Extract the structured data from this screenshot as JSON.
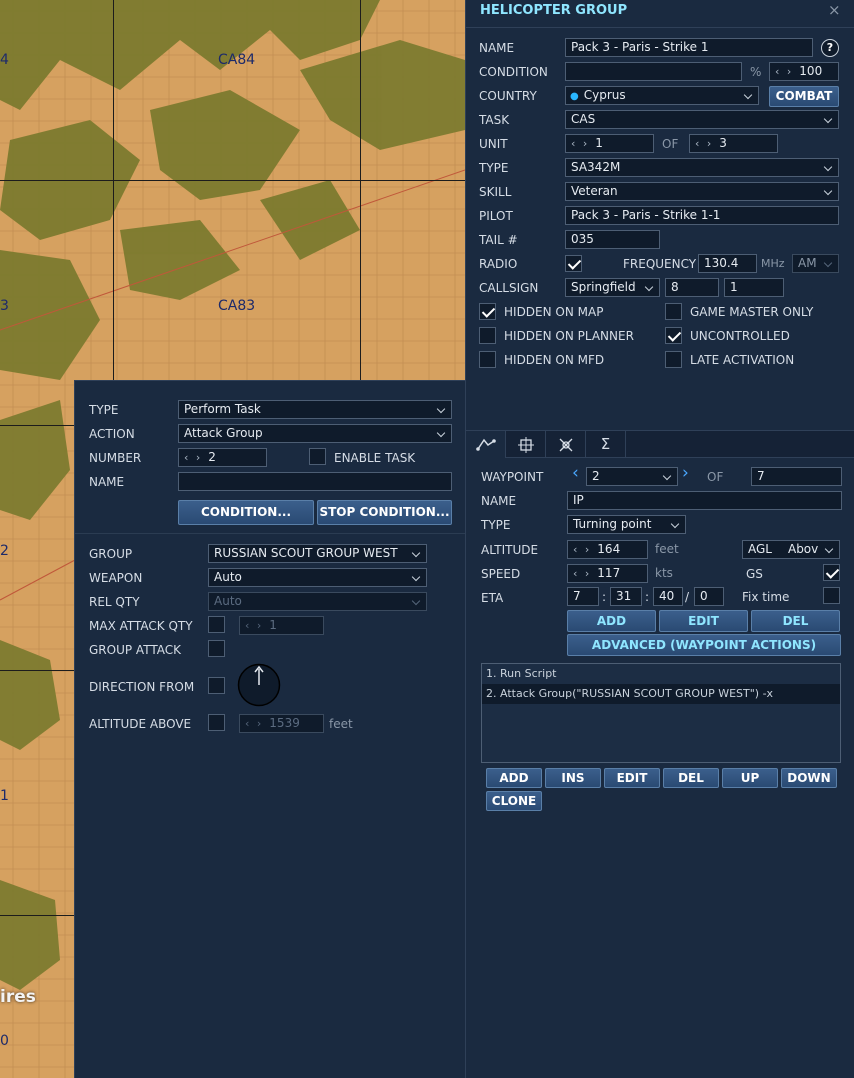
{
  "map": {
    "grid_labels": [
      "CA84",
      "CA83"
    ],
    "edge_labels": [
      "4",
      "3",
      "2",
      "1",
      "0"
    ],
    "town_label": "ires"
  },
  "heli": {
    "title": "HELICOPTER GROUP",
    "close": "×",
    "name_label": "NAME",
    "name_value": "Pack 3 - Paris - Strike 1",
    "help": "?",
    "condition_label": "CONDITION",
    "percent": "%",
    "probability": "100",
    "country_label": "COUNTRY",
    "country_value": "Cyprus",
    "combat": "COMBAT",
    "task_label": "TASK",
    "task_value": "CAS",
    "unit_label": "UNIT",
    "unit_value": "1",
    "of": "OF",
    "unit_total": "3",
    "type_label": "TYPE",
    "type_value": "SA342M",
    "skill_label": "SKILL",
    "skill_value": "Veteran",
    "pilot_label": "PILOT",
    "pilot_value": "Pack 3 - Paris - Strike 1-1",
    "tail_label": "TAIL #",
    "tail_value": "035",
    "radio_label": "RADIO",
    "frequency_label": "FREQUENCY",
    "frequency_value": "130.4",
    "mhz": "MHz",
    "modulation": "AM",
    "callsign_label": "CALLSIGN",
    "callsign_value": "Springfield",
    "callsign_num1": "8",
    "callsign_num2": "1",
    "hidden_map": "HIDDEN ON MAP",
    "game_master": "GAME MASTER ONLY",
    "hidden_planner": "HIDDEN ON PLANNER",
    "uncontrolled": "UNCONTROLLED",
    "hidden_mfd": "HIDDEN ON MFD",
    "late_activation": "LATE ACTIVATION"
  },
  "tabs": {
    "sum": "Σ"
  },
  "waypoint": {
    "waypoint_label": "WAYPOINT",
    "waypoint_value": "2",
    "of": "OF",
    "waypoint_total": "7",
    "name_label": "NAME",
    "name_value": "IP",
    "type_label": "TYPE",
    "type_value": "Turning point",
    "altitude_label": "ALTITUDE",
    "altitude_value": "164",
    "feet": "feet",
    "alt_type": "AGL",
    "alt_type2": "Abov",
    "speed_label": "SPEED",
    "speed_value": "117",
    "kts": "kts",
    "gs": "GS",
    "eta_label": "ETA",
    "eta_d": "7",
    "eta_h": "31",
    "eta_m": "40",
    "eta_s": "0",
    "colon": ":",
    "slash": "/",
    "fix_time": "Fix time",
    "add": "ADD",
    "edit": "EDIT",
    "del": "DEL",
    "advanced": "ADVANCED (WAYPOINT ACTIONS)",
    "actions": [
      "1. Run Script",
      "2. Attack Group(\"RUSSIAN SCOUT GROUP WEST\")  -x"
    ],
    "btn_add": "ADD",
    "btn_ins": "INS",
    "btn_edit": "EDIT",
    "btn_del": "DEL",
    "btn_up": "UP",
    "btn_down": "DOWN",
    "btn_clone": "CLONE"
  },
  "task": {
    "type_label": "TYPE",
    "type_value": "Perform Task",
    "action_label": "ACTION",
    "action_value": "Attack Group",
    "number_label": "NUMBER",
    "number_value": "2",
    "enable_task": "ENABLE TASK",
    "name_label": "NAME",
    "condition_btn": "CONDITION...",
    "stop_condition_btn": "STOP CONDITION...",
    "group_label": "GROUP",
    "group_value": "RUSSIAN SCOUT GROUP WEST",
    "weapon_label": "WEAPON",
    "weapon_value": "Auto",
    "relqty_label": "REL QTY",
    "relqty_value": "Auto",
    "max_attack_label": "MAX ATTACK QTY",
    "max_attack_value": "1",
    "group_attack_label": "GROUP ATTACK",
    "direction_label": "DIRECTION FROM",
    "altitude_label": "ALTITUDE ABOVE",
    "altitude_value": "1539",
    "feet": "feet"
  },
  "colors": {
    "bg": "#1a2a40",
    "field": "#0f1b2b",
    "title": "#8fe6ff",
    "map_terrain": "#d8a462",
    "map_forest": "#7a7a2e"
  }
}
